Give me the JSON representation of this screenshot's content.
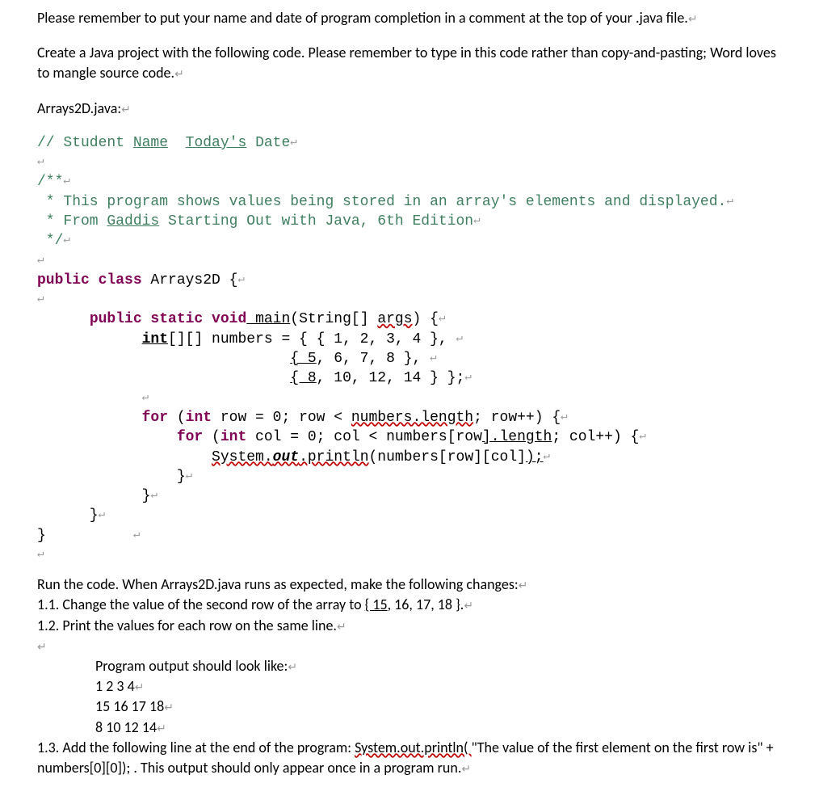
{
  "intro": {
    "p1a": "Please remember to put your name and date of program completion in a comment at the top of your .java file.",
    "p2a": "Create a Java project with the following code. Please remember to type in this code rather than copy-and-pasting; Word loves to mangle source code.",
    "p3": "Arrays2D.java:"
  },
  "code": {
    "l1_pre": "// Student ",
    "l1_name": "Name",
    "l1_sp": "  ",
    "l1_today": "Today's",
    "l1_post": " Date",
    "l3": "/**",
    "l4": " * This program shows values being stored in an array's elements and displayed.",
    "l5_pre": " * From ",
    "l5_g": "Gaddis",
    "l5_post": " Starting Out with Java, 6th Edition",
    "l6": " */",
    "l8_pub": "public",
    "l8_cls": " class",
    "l8_nm": " Arrays2D {",
    "l10_ind": "      ",
    "l10_pub": "public",
    "l10_st": " static",
    "l10_vd": " void",
    "l10_main": " main",
    "l10_mid": "(String[] ",
    "l10_args": "args",
    "l10_end": ") {",
    "l11_ind": "            ",
    "l11_int": "int",
    "l11_mid": "[][] numbers = { { 1, 2, 3, 4 }, ",
    "l12_ind": "                             ",
    "l12_a": "{ 5",
    "l12_b": ", 6, 7, 8 }, ",
    "l13_ind": "                             ",
    "l13_a": "{ 8",
    "l13_b": ", 10, 12, 14 } };",
    "l15_ind": "            ",
    "l15_for": "for",
    "l15_a": " (",
    "l15_int": "int",
    "l15_b": " row = 0; row < ",
    "l15_nl": "numbers.length",
    "l15_c": "; row++) {",
    "l16_ind": "                ",
    "l16_for": "for",
    "l16_a": " (",
    "l16_int": "int",
    "l16_b": " col = 0; col < numbers[row",
    "l16_len": "].length",
    "l16_c": "; col++) {",
    "l17_ind": "                    ",
    "l17_sys": "System.",
    "l17_out": "out",
    "l17_pr": ".println",
    "l17_a": "(numbers[row][col]",
    "l17_b": ");",
    "l18": "                }",
    "l19": "            }",
    "l20": "      }",
    "l21": "}          "
  },
  "post": {
    "run": "Run the code. When Arrays2D.java runs as expected, make the following changes:",
    "i1a": "1.1. Change the value of the second row of the array to ",
    "i1link": "{ 15",
    "i1b": ", 16, 17, 18 }.",
    "i2": "1.2. Print the values for each row on the same line.",
    "out_h": "Program output should look like:",
    "out1": "1 2 3 4",
    "out2": "15 16 17 18",
    "out3": "8 10 12 14",
    "i3a": "1.3. Add the following line at the end of the program: ",
    "i3sys": "System.out.println( ",
    "i3q": "\"The value of the first element on",
    "i3b": " the first row is\" + numbers[0][0]);  . This output should only appear once in a program run."
  },
  "pm": "↵"
}
